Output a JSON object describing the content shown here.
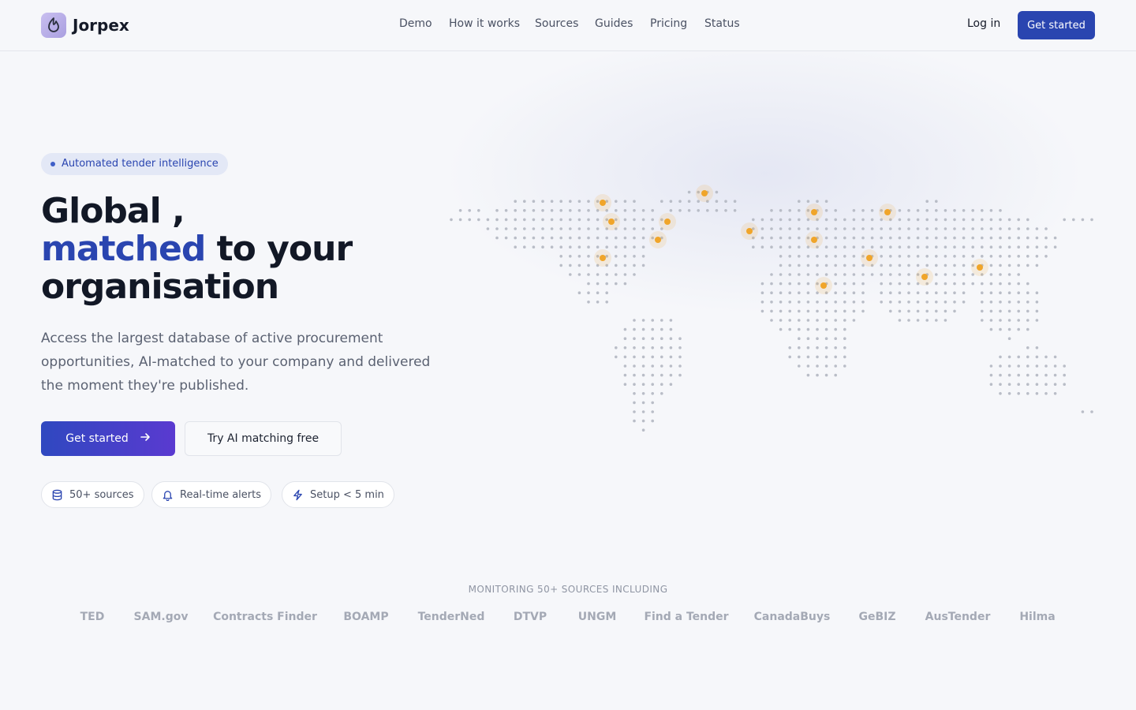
{
  "brand": {
    "name": "Jorpex",
    "logo_icon": "flame-icon"
  },
  "nav": {
    "links": [
      "Demo",
      "How it works",
      "Sources",
      "Guides",
      "Pricing",
      "Status"
    ],
    "login_label": "Log in",
    "get_started_label": "Get started"
  },
  "hero": {
    "badge": "Automated tender intelligence",
    "headline_line1": "Global ,",
    "headline_blue": "matched",
    "headline_rest": " to your",
    "headline_line3": "organisation",
    "subtitle": "Access the largest database of active procurement opportunities, AI-matched to your company and delivered the moment they're published.",
    "primary_cta": "Get started",
    "secondary_cta": "Try AI matching free",
    "chips": [
      {
        "icon": "database-icon",
        "label": "50+ sources"
      },
      {
        "icon": "bell-icon",
        "label": "Real-time alerts"
      },
      {
        "icon": "lightning-icon",
        "label": "Setup < 5 min"
      }
    ]
  },
  "sources_section": {
    "label": "MONITORING 50+ SOURCES INCLUDING",
    "sources": [
      "TED",
      "SAM.gov",
      "Contracts Finder",
      "BOAMP",
      "TenderNed",
      "DTVP",
      "UNGM",
      "Find a Tender",
      "CanadaBuys",
      "GeBIZ",
      "AusTender",
      "Hilma"
    ]
  },
  "colors": {
    "accent": "#2a45b0",
    "gradient_start": "#2f48c0",
    "gradient_end": "#5a3ad0",
    "map_dot": "#b9bdc7",
    "highlight": "#f0a52a"
  }
}
